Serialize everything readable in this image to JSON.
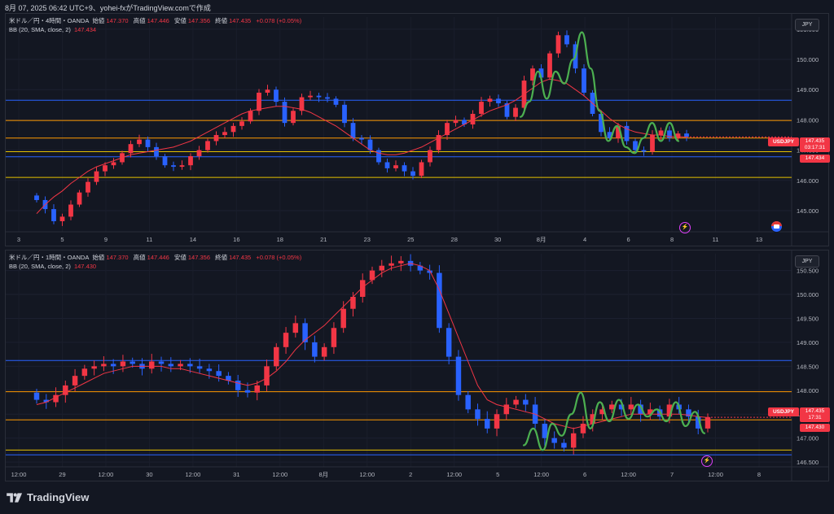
{
  "header": {
    "caption": "8月 07, 2025 06:42 UTC+9、yohei-fxがTradingView.comで作成"
  },
  "footer": {
    "brand": "TradingView",
    "logo_icon": "tradingview-logo-icon"
  },
  "colors": {
    "up": "#f23645",
    "down": "#2962ff",
    "bb_mid": "#f23645",
    "wave": "#4caf50",
    "blue_line": "#2962ff",
    "orange_line": "#ff9800",
    "yellow_line": "#e5c100"
  },
  "chart_data": [
    {
      "type": "candlestick",
      "symbol": "USDJPY",
      "legend": {
        "title": "米ドル／円・4時間・OANDA",
        "open_label": "始値",
        "open": "147.370",
        "high_label": "高値",
        "high": "147.446",
        "low_label": "安値",
        "low": "147.356",
        "close_label": "終値",
        "close": "147.435",
        "change": "+0.078 (+0.05%)",
        "bb_label": "BB (20, SMA, close, 2)",
        "bb_value": "147.434"
      },
      "currency": "JPY",
      "ylim": [
        144.3,
        151.4
      ],
      "y_ticks": [
        "145.000",
        "146.000",
        "147.000",
        "148.000",
        "149.000",
        "150.000",
        "151.000"
      ],
      "x_ticks": [
        "3",
        "5",
        "9",
        "11",
        "14",
        "16",
        "18",
        "21",
        "23",
        "25",
        "28",
        "30",
        "8月",
        "4",
        "6",
        "8",
        "11",
        "13"
      ],
      "price_tag": {
        "symbol": "USDJPY",
        "price": "147.435",
        "countdown": "03:17:31",
        "bb": "147.434"
      },
      "horizontal_lines": [
        {
          "price": 148.65,
          "color": "blue"
        },
        {
          "price": 147.98,
          "color": "orange"
        },
        {
          "price": 147.4,
          "color": "orange"
        },
        {
          "price": 146.95,
          "color": "yellow"
        },
        {
          "price": 146.78,
          "color": "blue"
        },
        {
          "price": 146.1,
          "color": "yellow"
        }
      ],
      "closes": [
        145.35,
        145.05,
        144.65,
        144.8,
        145.2,
        145.6,
        145.95,
        146.3,
        146.5,
        146.6,
        146.9,
        147.2,
        147.35,
        147.1,
        146.8,
        146.5,
        146.45,
        146.5,
        146.8,
        147.0,
        147.3,
        147.5,
        147.6,
        147.8,
        147.95,
        148.3,
        148.9,
        149.0,
        148.6,
        147.9,
        148.3,
        148.75,
        148.8,
        148.75,
        148.7,
        148.5,
        147.9,
        147.4,
        147.35,
        147.0,
        146.6,
        146.4,
        146.5,
        146.3,
        146.15,
        146.6,
        147.0,
        147.5,
        147.9,
        148.0,
        147.85,
        148.2,
        148.6,
        148.7,
        148.55,
        148.1,
        148.4,
        149.3,
        149.7,
        149.4,
        150.2,
        150.8,
        150.5,
        149.7,
        148.9,
        148.2,
        147.6,
        147.4,
        147.8,
        147.3,
        147.0,
        146.95,
        147.5,
        147.65,
        147.4,
        147.55,
        147.44
      ],
      "bb_mid": [
        144.9,
        145.2,
        145.45,
        145.65,
        145.9,
        146.1,
        146.3,
        146.45,
        146.55,
        146.65,
        146.75,
        146.85,
        146.9,
        146.95,
        147.0,
        147.05,
        147.1,
        147.2,
        147.3,
        147.45,
        147.6,
        147.75,
        147.9,
        148.05,
        148.2,
        148.3,
        148.35,
        148.4,
        148.45,
        148.45,
        148.4,
        148.35,
        148.25,
        148.1,
        147.95,
        147.8,
        147.6,
        147.4,
        147.2,
        147.0,
        146.9,
        146.85,
        146.85,
        146.9,
        147.0,
        147.1,
        147.25,
        147.4,
        147.55,
        147.7,
        147.85,
        148.0,
        148.15,
        148.3,
        148.4,
        148.5,
        148.65,
        148.85,
        149.05,
        149.25,
        149.35,
        149.3,
        149.2,
        149.0,
        148.8,
        148.55,
        148.3,
        148.05,
        147.85,
        147.7,
        147.6,
        147.55,
        147.5,
        147.5,
        147.45,
        147.45,
        147.43
      ],
      "wave_path": [
        148.1,
        148.6,
        149.6,
        148.7,
        149.6,
        149.2,
        150.0,
        150.9,
        149.7,
        148.3,
        147.3,
        147.8,
        147.1,
        146.9,
        147.4,
        147.9,
        147.3,
        147.9,
        147.3
      ]
    },
    {
      "type": "candlestick",
      "symbol": "USDJPY",
      "legend": {
        "title": "米ドル／円・1時間・OANDA",
        "open_label": "始値",
        "open": "147.370",
        "high_label": "高値",
        "high": "147.446",
        "low_label": "安値",
        "low": "147.356",
        "close_label": "終値",
        "close": "147.435",
        "change": "+0.078 (+0.05%)",
        "bb_label": "BB (20, SMA, close, 2)",
        "bb_value": "147.430"
      },
      "currency": "JPY",
      "ylim": [
        146.4,
        150.85
      ],
      "y_ticks": [
        "146.500",
        "147.000",
        "147.500",
        "148.000",
        "148.500",
        "149.000",
        "149.500",
        "150.000",
        "150.500"
      ],
      "x_ticks": [
        "12:00",
        "29",
        "12:00",
        "30",
        "12:00",
        "31",
        "12:00",
        "8月",
        "12:00",
        "2",
        "12:00",
        "5",
        "12:00",
        "6",
        "12:00",
        "7",
        "12:00",
        "8"
      ],
      "price_tag": {
        "symbol": "USDJPY",
        "price": "147.435",
        "countdown": "17:31",
        "bb": "147.430"
      },
      "horizontal_lines": [
        {
          "price": 148.62,
          "color": "blue"
        },
        {
          "price": 147.97,
          "color": "orange"
        },
        {
          "price": 147.38,
          "color": "orange"
        },
        {
          "price": 146.75,
          "color": "yellow"
        },
        {
          "price": 146.65,
          "color": "blue"
        }
      ],
      "closes": [
        147.8,
        147.75,
        147.9,
        148.1,
        148.3,
        148.45,
        148.5,
        148.55,
        148.5,
        148.6,
        148.55,
        148.45,
        148.6,
        148.55,
        148.5,
        148.55,
        148.5,
        148.45,
        148.4,
        148.3,
        148.2,
        148.0,
        147.95,
        148.1,
        148.5,
        148.9,
        149.2,
        149.4,
        149.0,
        148.7,
        148.9,
        149.3,
        149.7,
        149.95,
        150.3,
        150.5,
        150.6,
        150.65,
        150.7,
        150.6,
        150.5,
        150.45,
        149.3,
        148.7,
        147.9,
        147.6,
        147.4,
        147.2,
        147.5,
        147.7,
        147.8,
        147.7,
        147.3,
        147.0,
        146.9,
        146.8,
        147.1,
        147.3,
        147.5,
        147.6,
        147.7,
        147.6,
        147.7,
        147.5,
        147.6,
        147.45,
        147.7,
        147.6,
        147.45,
        147.2,
        147.435
      ],
      "bb_mid": [
        147.7,
        147.75,
        147.85,
        147.95,
        148.05,
        148.15,
        148.25,
        148.35,
        148.4,
        148.45,
        148.5,
        148.5,
        148.5,
        148.5,
        148.45,
        148.45,
        148.4,
        148.35,
        148.3,
        148.25,
        148.2,
        148.15,
        148.1,
        148.15,
        148.25,
        148.4,
        148.6,
        148.85,
        149.05,
        149.2,
        149.35,
        149.55,
        149.75,
        149.95,
        150.15,
        150.3,
        150.45,
        150.55,
        150.6,
        150.65,
        150.6,
        150.5,
        150.1,
        149.6,
        149.1,
        148.6,
        148.1,
        147.8,
        147.7,
        147.65,
        147.6,
        147.55,
        147.5,
        147.4,
        147.3,
        147.25,
        147.2,
        147.25,
        147.3,
        147.35,
        147.4,
        147.45,
        147.5,
        147.5,
        147.5,
        147.5,
        147.5,
        147.5,
        147.48,
        147.45,
        147.43
      ],
      "wave_path": [
        146.85,
        147.2,
        146.75,
        147.3,
        147.05,
        147.5,
        147.95,
        147.2,
        147.75,
        147.35,
        147.8,
        147.4,
        147.7,
        147.45,
        147.6,
        147.35,
        147.75,
        147.25,
        147.55,
        147.1
      ]
    }
  ]
}
